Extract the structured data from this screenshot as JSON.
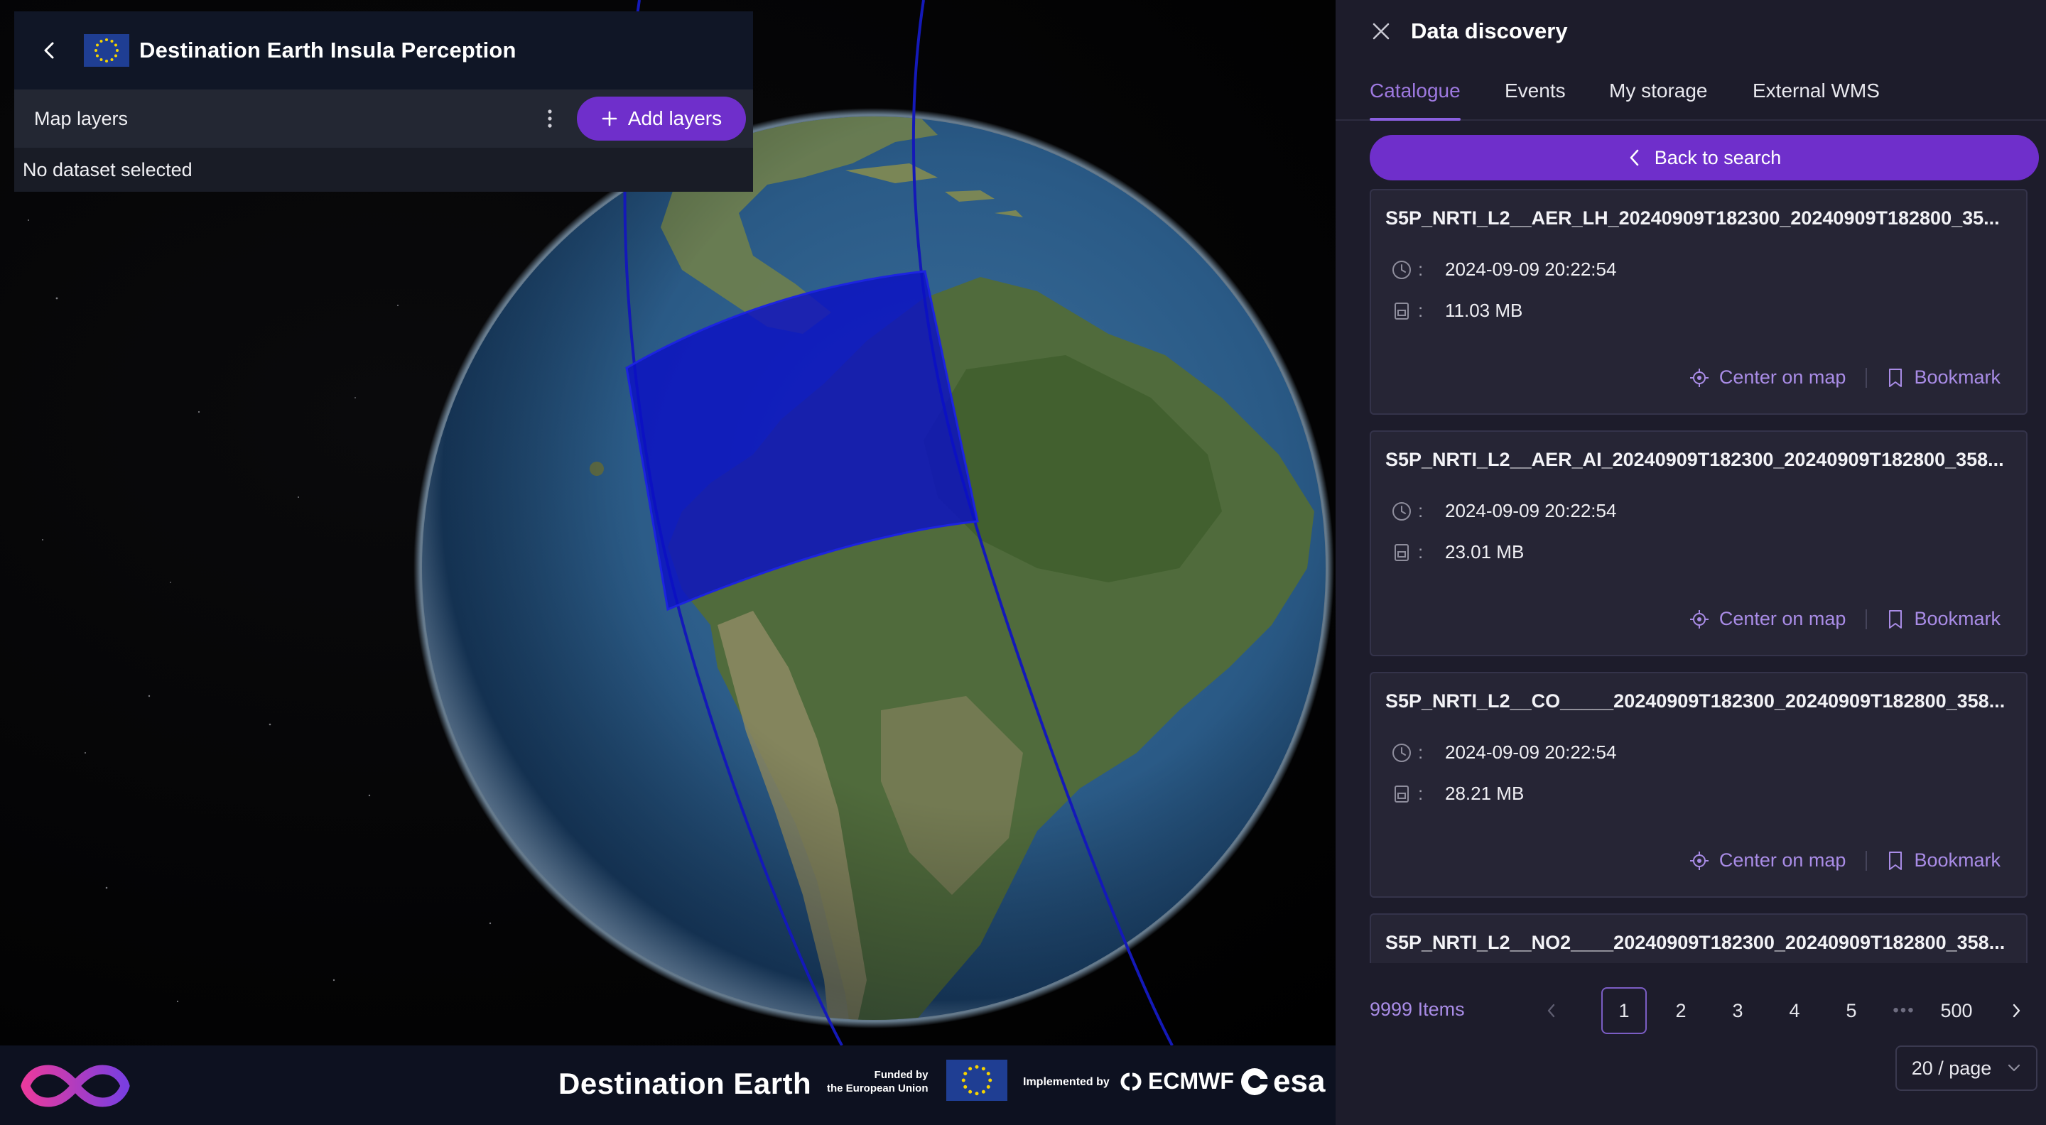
{
  "app": {
    "title": "Destination Earth Insula Perception"
  },
  "layers_panel": {
    "label": "Map layers",
    "add_button": "Add layers",
    "empty_text": "No dataset selected"
  },
  "footer": {
    "brand": "Destination Earth",
    "funded_line1": "Funded by",
    "funded_line2": "the European Union",
    "implemented_by": "Implemented by",
    "ecmwf": "ECMWF",
    "esa": "esa"
  },
  "discovery": {
    "title": "Data discovery",
    "tabs": [
      {
        "label": "Catalogue",
        "active": true
      },
      {
        "label": "Events",
        "active": false
      },
      {
        "label": "My storage",
        "active": false
      },
      {
        "label": "External WMS",
        "active": false
      }
    ],
    "back_button": "Back to search",
    "results": [
      {
        "name": "S5P_NRTI_L2__AER_LH_20240909T182300_20240909T182800_35...",
        "time": "2024-09-09 20:22:54",
        "size": "11.03 MB"
      },
      {
        "name": "S5P_NRTI_L2__AER_AI_20240909T182300_20240909T182800_358...",
        "time": "2024-09-09 20:22:54",
        "size": "23.01 MB"
      },
      {
        "name": "S5P_NRTI_L2__CO_____20240909T182300_20240909T182800_358...",
        "time": "2024-09-09 20:22:54",
        "size": "28.21 MB"
      },
      {
        "name": "S5P_NRTI_L2__NO2____20240909T182300_20240909T182800_358...",
        "time": "",
        "size": ""
      }
    ],
    "center_label": "Center on map",
    "bookmark_label": "Bookmark",
    "colon": ":",
    "pagination": {
      "total": "9999 Items",
      "pages": [
        "1",
        "2",
        "3",
        "4",
        "5"
      ],
      "current": "1",
      "ellipsis": "•••",
      "last": "500",
      "page_size": "20 / page"
    }
  },
  "colors": {
    "accent": "#6f2fcb",
    "link": "#a98ce6",
    "footprint": "#0a12c8"
  }
}
